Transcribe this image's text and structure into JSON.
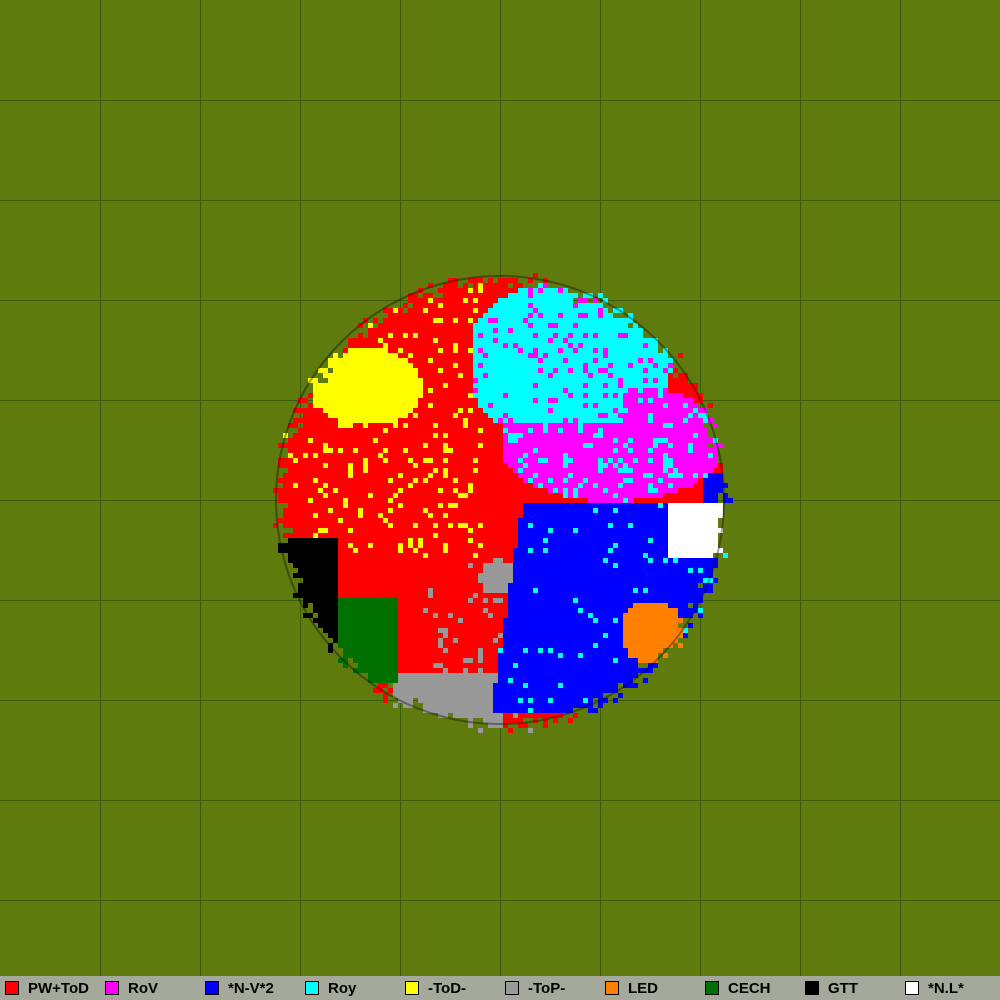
{
  "map": {
    "background_color": "#5f7a0d",
    "grid_color": "#3b5a0a",
    "outline_color": "#000000"
  },
  "legend": [
    {
      "key": "pwtod",
      "label": "PW+ToD",
      "color": "#ff0000",
      "icon": "red-square-icon"
    },
    {
      "key": "rov",
      "label": "RoV",
      "color": "#ff00ff",
      "icon": "magenta-square-icon"
    },
    {
      "key": "nv2",
      "label": "*N-V*2",
      "color": "#0000ff",
      "icon": "blue-square-icon"
    },
    {
      "key": "roy",
      "label": "Roy",
      "color": "#00ffff",
      "icon": "cyan-square-icon"
    },
    {
      "key": "tod",
      "label": "-ToD-",
      "color": "#ffff00",
      "icon": "yellow-square-icon"
    },
    {
      "key": "top",
      "label": "-ToP-",
      "color": "#999999",
      "icon": "gray-square-icon"
    },
    {
      "key": "led",
      "label": "LED",
      "color": "#ff8000",
      "icon": "orange-square-icon"
    },
    {
      "key": "cech",
      "label": "CECH",
      "color": "#007000",
      "icon": "green-square-icon"
    },
    {
      "key": "gtt",
      "label": "GTT",
      "color": "#000000",
      "icon": "black-square-icon"
    },
    {
      "key": "nl",
      "label": "*N.L*",
      "color": "#ffffff",
      "icon": "white-square-icon"
    }
  ]
}
